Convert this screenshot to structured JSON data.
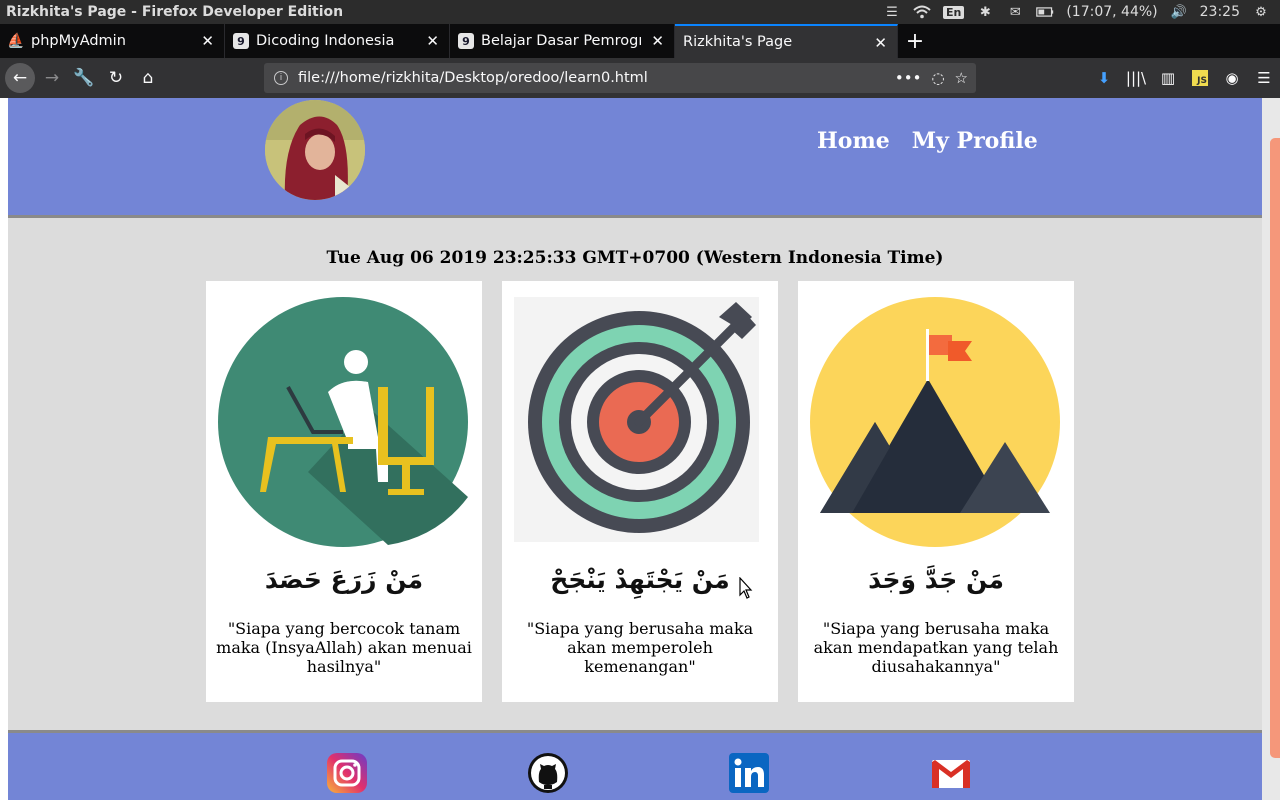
{
  "os": {
    "window_title": "Rizkhita's Page - Firefox Developer Edition",
    "language": "En",
    "battery": "(17:07, 44%)",
    "clock": "23:25"
  },
  "tabs": [
    {
      "label": "phpMyAdmin",
      "icon": "phpmyadmin-icon",
      "active": false
    },
    {
      "label": "Dicoding Indonesia",
      "icon": "dicoding-icon",
      "active": false
    },
    {
      "label": "Belajar Dasar Pemrogra",
      "icon": "dicoding-icon",
      "active": false
    },
    {
      "label": "Rizkhita's Page",
      "icon": "none",
      "active": true
    }
  ],
  "urlbar": {
    "url": "file:///home/rizkhita/Desktop/oredoo/learn0.html"
  },
  "site": {
    "menu": {
      "home": "Home",
      "profile": "My Profile"
    },
    "datetime": "Tue Aug 06 2019 23:25:33 GMT+0700 (Western Indonesia Time)",
    "cards": [
      {
        "arabic": "مَنْ زَرَعَ حَصَدَ",
        "quote": "\"Siapa yang bercocok tanam maka (InsyaAllah) akan menuai hasilnya\"",
        "illustration": "person-at-laptop"
      },
      {
        "arabic": "مَنْ يَجْتَهِدْ يَنْجَحْ",
        "quote": "\"Siapa yang berusaha maka akan memperoleh kemenangan\"",
        "illustration": "target-with-arrow"
      },
      {
        "arabic": "مَنْ جَدَّ وَجَدَ",
        "quote": "\"Siapa yang berusaha maka akan mendapatkan yang telah diusahakannya\"",
        "illustration": "mountain-with-flag"
      }
    ],
    "social": [
      "instagram-icon",
      "github-icon",
      "linkedin-icon",
      "gmail-icon"
    ]
  },
  "colors": {
    "header_bg": "#7385d6",
    "page_bg": "#dcdcdc",
    "card_bg": "#ffffff"
  }
}
